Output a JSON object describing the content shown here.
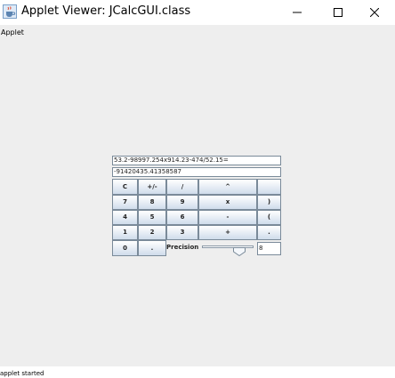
{
  "window": {
    "title": "Applet Viewer: JCalcGUI.class",
    "menu_label": "Applet",
    "status": "applet started"
  },
  "calculator": {
    "expression": "53.2-98997.254x914.23-474/52.15=",
    "result": "-91420435.41358587",
    "buttons": [
      [
        "C",
        "+/-",
        "/",
        "^",
        ""
      ],
      [
        "7",
        "8",
        "9",
        "x",
        ")"
      ],
      [
        "4",
        "5",
        "6",
        "-",
        "("
      ],
      [
        "1",
        "2",
        "3",
        "+",
        "."
      ],
      [
        "0",
        ".",
        "",
        "",
        ""
      ]
    ],
    "precision_label": "Precision",
    "precision_value": "8",
    "precision_slider_fraction": 0.8
  }
}
